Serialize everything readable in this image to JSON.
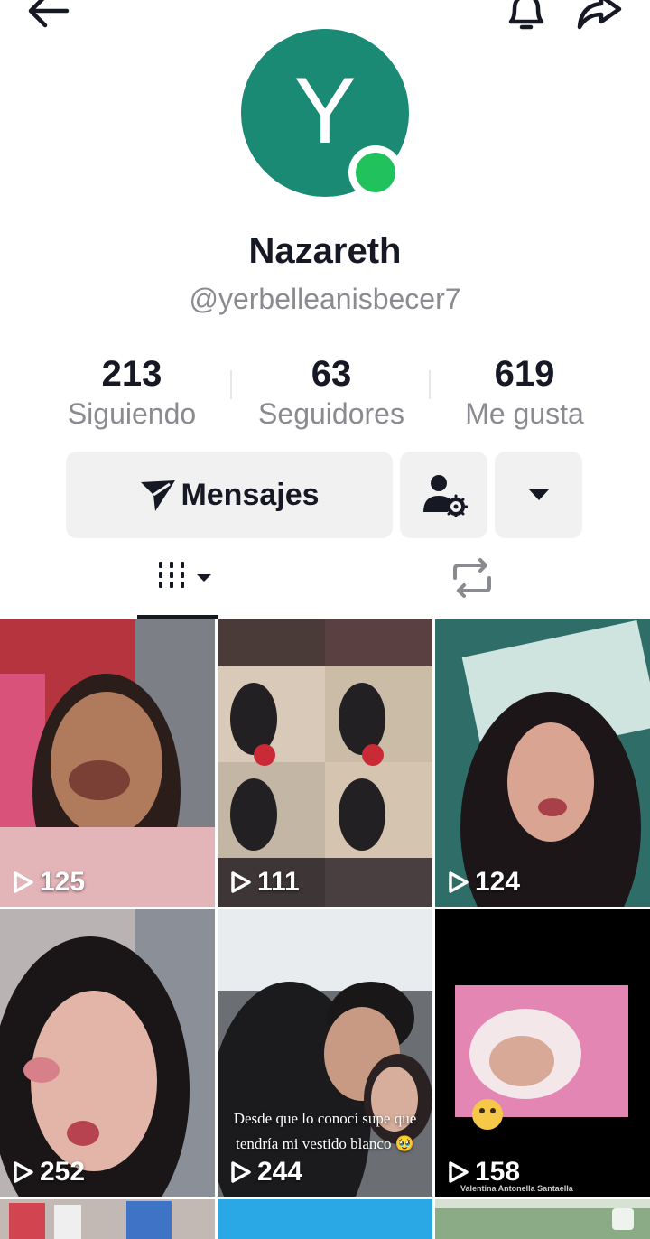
{
  "profile": {
    "avatar_letter": "Y",
    "display_name": "Nazareth",
    "username": "@yerbelleanisbecer7",
    "online": true
  },
  "stats": [
    {
      "value": "213",
      "label": "Siguiendo"
    },
    {
      "value": "63",
      "label": "Seguidores"
    },
    {
      "value": "619",
      "label": "Me gusta"
    }
  ],
  "actions": {
    "message_label": "Mensajes"
  },
  "icons": {
    "back": "arrow-left-icon",
    "bell": "bell-icon",
    "share": "share-icon",
    "send": "paper-plane-icon",
    "add_friend": "person-gear-icon",
    "more": "caret-down-icon",
    "videos_tab": "grid-icon",
    "reposts_tab": "repost-icon"
  },
  "colors": {
    "avatar": "#1a8a74",
    "online": "#21c25e",
    "button_bg": "#f1f1f2"
  },
  "videos": [
    {
      "views": "125",
      "caption": ""
    },
    {
      "views": "111",
      "caption": ""
    },
    {
      "views": "124",
      "caption": ""
    },
    {
      "views": "252",
      "caption": ""
    },
    {
      "views": "244",
      "caption": "Desde que lo conocí supe que tendría mi vestido blanco 🥹"
    },
    {
      "views": "158",
      "caption": "Valentina Antonella Santaella"
    }
  ]
}
